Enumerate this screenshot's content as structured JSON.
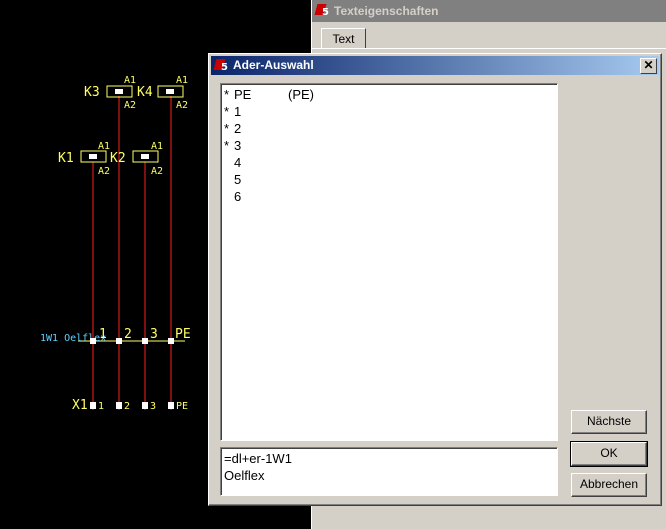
{
  "background_window": {
    "title": "Texteigenschaften",
    "tab": "Text"
  },
  "dialog": {
    "title": "Ader-Auswahl",
    "close_glyph": "✕",
    "wires": [
      {
        "star": "*",
        "name": "PE",
        "alt": "(PE)"
      },
      {
        "star": "*",
        "name": "1",
        "alt": ""
      },
      {
        "star": "*",
        "name": "2",
        "alt": ""
      },
      {
        "star": "*",
        "name": "3",
        "alt": ""
      },
      {
        "star": "",
        "name": "4",
        "alt": ""
      },
      {
        "star": "",
        "name": "5",
        "alt": ""
      },
      {
        "star": "",
        "name": "6",
        "alt": ""
      }
    ],
    "info_lines": [
      "=dl+er-1W1",
      "Oelflex"
    ],
    "buttons": {
      "next": "Nächste",
      "ok": "OK",
      "cancel": "Abbrechen"
    }
  },
  "schematic": {
    "contactors_top": [
      "K3",
      "K4"
    ],
    "contactors_mid": [
      "K1",
      "K2"
    ],
    "pin_top": "A1",
    "pin_bottom": "A2",
    "cable_label": "1W1 Oelflex",
    "cable_wires": [
      "1",
      "2",
      "3",
      "PE"
    ],
    "terminal_strip": "X1",
    "terminals": [
      "1",
      "2",
      "3",
      "PE"
    ],
    "colors": {
      "text": "#ffff66",
      "wire": "#ff2020",
      "cable": "#5fd0ff"
    }
  }
}
